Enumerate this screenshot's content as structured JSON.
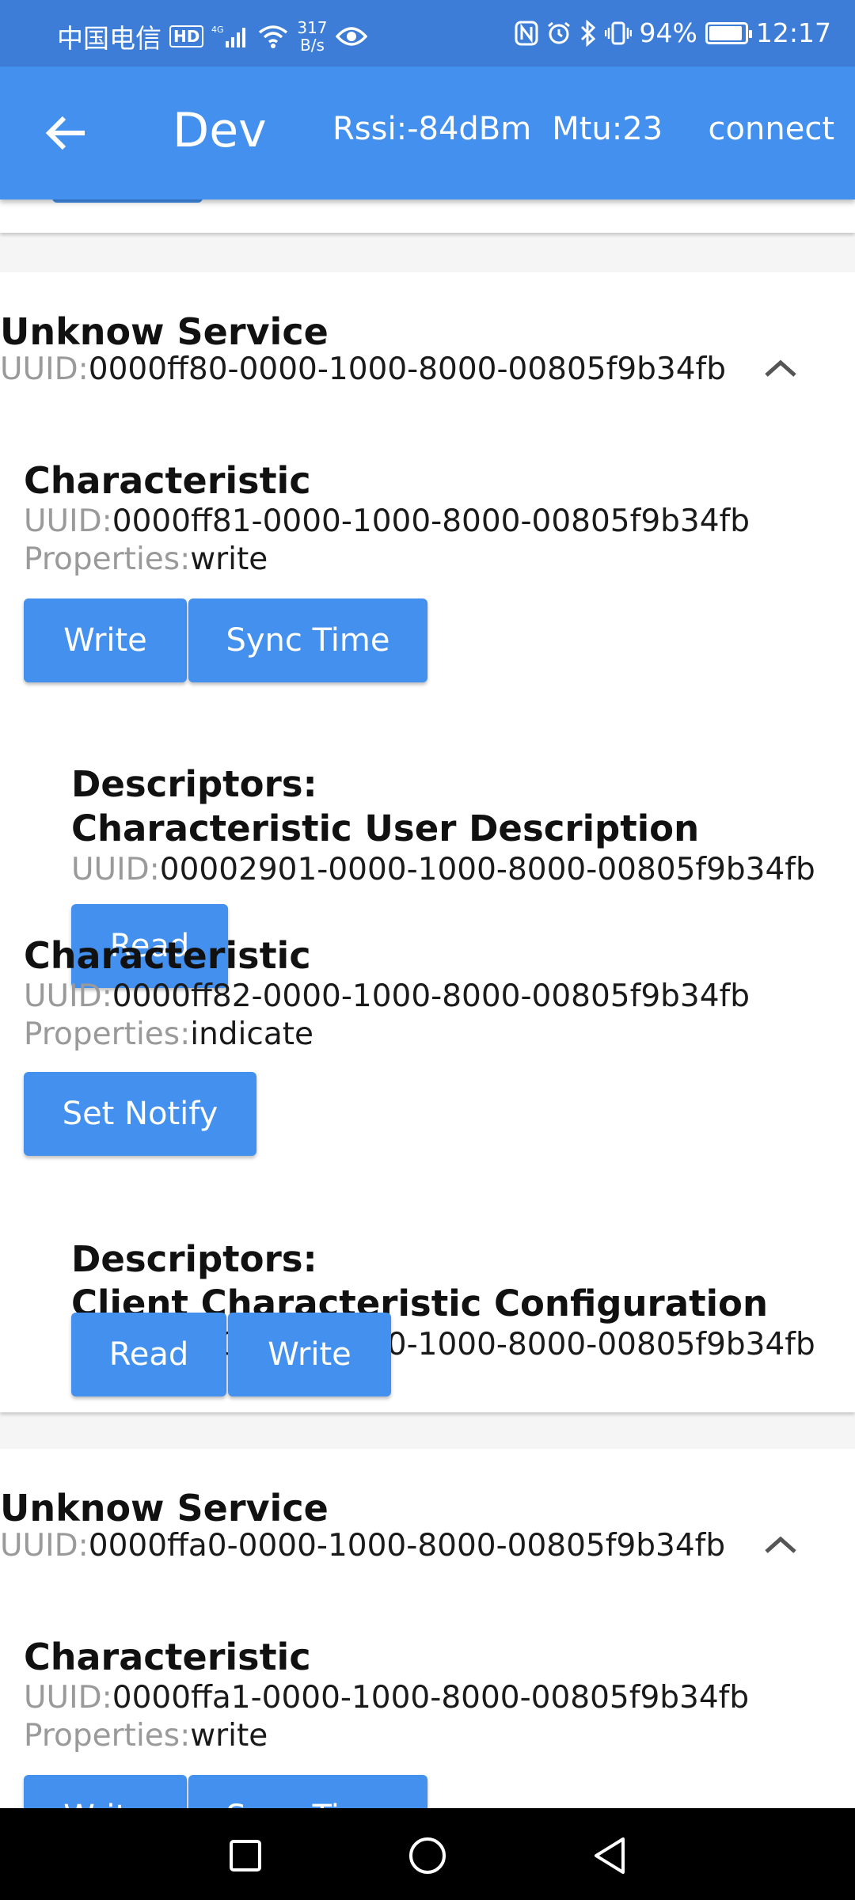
{
  "status_bar": {
    "carrier": "中国电信",
    "hd": "HD",
    "network": "4G",
    "speed_value": "317",
    "speed_unit": "B/s",
    "battery": "94%",
    "battery_level": 0.94,
    "time": "12:17"
  },
  "app_bar": {
    "title": "Dev",
    "rssi": "Rssi:-84dBm",
    "mtu": "Mtu:23",
    "action": "connect"
  },
  "uuid_label": "UUID:",
  "properties_label": "Properties:",
  "services": [
    {
      "title": "Unknow Service",
      "uuid": "0000ff80-0000-1000-8000-00805f9b34fb",
      "characteristics": [
        {
          "title": "Characteristic",
          "uuid": "0000ff81-0000-1000-8000-00805f9b34fb",
          "properties": "write",
          "buttons": [
            "Write",
            "Sync Time"
          ],
          "descriptor_heading": "Descriptors:",
          "descriptor_name": "Characteristic User Description",
          "descriptor_uuid": "00002901-0000-1000-8000-00805f9b34fb",
          "descriptor_buttons": [
            "Read"
          ]
        },
        {
          "title": "Characteristic",
          "uuid": "0000ff82-0000-1000-8000-00805f9b34fb",
          "properties": "indicate",
          "buttons": [
            "Set Notify"
          ],
          "descriptor_heading": "Descriptors:",
          "descriptor_name": "Client Characteristic Configuration",
          "descriptor_uuid": "00002902-0000-1000-8000-00805f9b34fb",
          "descriptor_buttons": [
            "Read",
            "Write"
          ]
        }
      ]
    },
    {
      "title": "Unknow Service",
      "uuid": "0000ffa0-0000-1000-8000-00805f9b34fb",
      "characteristics": [
        {
          "title": "Characteristic",
          "uuid": "0000ffa1-0000-1000-8000-00805f9b34fb",
          "properties": "write",
          "buttons": [
            "Write",
            "Sync Time"
          ]
        }
      ]
    }
  ],
  "icons": {
    "back": "arrow-left-icon",
    "collapse": "chevron-up-icon",
    "nav_recent": "square-icon",
    "nav_home": "circle-icon",
    "nav_back": "triangle-left-icon"
  },
  "colors": {
    "status_bar": "#3d7dd8",
    "app_bar": "#4390ee",
    "button": "#4390ee",
    "label_gray": "#9a9a9a"
  }
}
